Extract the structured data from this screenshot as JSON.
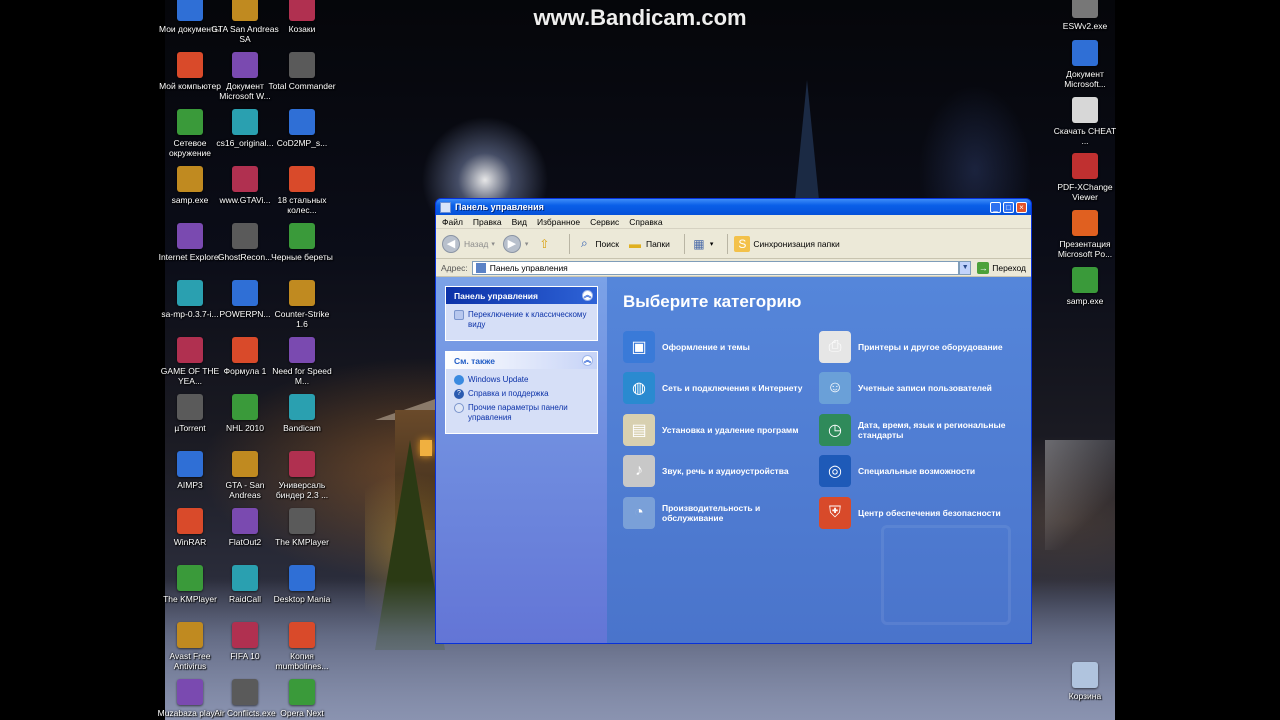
{
  "watermark": "www.Bandicam.com",
  "desktop_icons": {
    "col1": [
      {
        "label": "Мои документы",
        "icon": "folder-documents-icon"
      },
      {
        "label": "Мой компьютер",
        "icon": "computer-icon"
      },
      {
        "label": "Сетевое окружение",
        "icon": "network-icon"
      },
      {
        "label": "samp.exe",
        "icon": "samp-icon"
      },
      {
        "label": "Internet Explorer",
        "icon": "ie-icon"
      },
      {
        "label": "sa-mp-0.3.7-i...",
        "icon": "samp-installer-icon"
      },
      {
        "label": "GAME OF THE YEA...",
        "icon": "game-icon"
      },
      {
        "label": "µTorrent",
        "icon": "utorrent-icon"
      },
      {
        "label": "AIMP3",
        "icon": "aimp-icon"
      },
      {
        "label": "WinRAR",
        "icon": "winrar-icon"
      },
      {
        "label": "The KMPlayer",
        "icon": "kmplayer-icon"
      },
      {
        "label": "Avast Free Antivirus",
        "icon": "avast-icon"
      },
      {
        "label": "Muzabaza player",
        "icon": "muzabaza-icon"
      }
    ],
    "col2": [
      {
        "label": "GTA San Andreas SA",
        "icon": "gta-icon"
      },
      {
        "label": "Документ Microsoft W...",
        "icon": "word-doc-icon"
      },
      {
        "label": "cs16_original...",
        "icon": "archive-icon"
      },
      {
        "label": "www.GTAVi...",
        "icon": "opera-link-icon"
      },
      {
        "label": "GhostRecon...",
        "icon": "ghostrecon-icon"
      },
      {
        "label": "POWERPN...",
        "icon": "powerpoint-icon"
      },
      {
        "label": "Формула 1",
        "icon": "formula1-icon"
      },
      {
        "label": "NHL 2010",
        "icon": "nhl-icon"
      },
      {
        "label": "GTA - San Andreas",
        "icon": "gta-sa-icon"
      },
      {
        "label": "FlatOut2",
        "icon": "flatout-icon"
      },
      {
        "label": "RaidCall",
        "icon": "raidcall-icon"
      },
      {
        "label": "FIFA 10",
        "icon": "fifa-icon"
      },
      {
        "label": "Air Conflicts.exe",
        "icon": "airconflicts-icon"
      }
    ],
    "col3": [
      {
        "label": "Козаки",
        "icon": "kozaki-icon"
      },
      {
        "label": "Total Commander",
        "icon": "totalcmd-icon"
      },
      {
        "label": "CoD2MP_s...",
        "icon": "cod2-icon"
      },
      {
        "label": "18 стальных колес...",
        "icon": "truck-icon"
      },
      {
        "label": "Черные береты",
        "icon": "beret-icon"
      },
      {
        "label": "Counter-Strike 1.6",
        "icon": "cs-icon"
      },
      {
        "label": "Need for Speed M...",
        "icon": "nfs-icon"
      },
      {
        "label": "Bandicam",
        "icon": "bandicam-icon"
      },
      {
        "label": "Универсаль биндер 2.3 ...",
        "icon": "binder-icon"
      },
      {
        "label": "The KMPlayer",
        "icon": "kmplayer2-icon"
      },
      {
        "label": "Desktop Mania",
        "icon": "desktopmania-icon"
      },
      {
        "label": "Копия mumbolines...",
        "icon": "copy-icon"
      },
      {
        "label": "Opera Next",
        "icon": "opera-icon"
      }
    ],
    "right": [
      {
        "label": "ESWv2.exe",
        "icon": "exe-icon"
      },
      {
        "label": "Документ Microsoft...",
        "icon": "word-doc-icon"
      },
      {
        "label": "Скачать CHEAT ...",
        "icon": "cheat-icon"
      },
      {
        "label": "PDF-XChange Viewer",
        "icon": "pdf-icon"
      },
      {
        "label": "Презентация Microsoft Po...",
        "icon": "ppt-icon"
      },
      {
        "label": "samp.exe",
        "icon": "samp-exe-icon"
      },
      {
        "label": "Корзина",
        "icon": "recycle-bin-icon"
      }
    ]
  },
  "window": {
    "title": "Панель управления",
    "menu": [
      "Файл",
      "Правка",
      "Вид",
      "Избранное",
      "Сервис",
      "Справка"
    ],
    "toolbar": {
      "back": "Назад",
      "search": "Поиск",
      "folders": "Папки",
      "sync": "Синхронизация папки"
    },
    "address": {
      "label": "Адрес:",
      "value": "Панель управления",
      "go": "Переход"
    },
    "sidebar": {
      "panel_title": "Панель управления",
      "panel_items": [
        "Переключение к классическому виду"
      ],
      "see_also_title": "См. также",
      "see_also_items": [
        "Windows Update",
        "Справка и поддержка",
        "Прочие параметры панели управления"
      ]
    },
    "heading": "Выберите категорию",
    "categories": [
      {
        "label": "Оформление и темы",
        "icon": "appearance-icon"
      },
      {
        "label": "Принтеры и другое оборудование",
        "icon": "printer-icon"
      },
      {
        "label": "Сеть и подключения к Интернету",
        "icon": "network-connections-icon"
      },
      {
        "label": "Учетные записи пользователей",
        "icon": "user-accounts-icon"
      },
      {
        "label": "Установка и удаление программ",
        "icon": "add-remove-icon"
      },
      {
        "label": "Дата, время, язык и региональные стандарты",
        "icon": "datetime-icon"
      },
      {
        "label": "Звук, речь и аудиоустройства",
        "icon": "sound-icon"
      },
      {
        "label": "Специальные возможности",
        "icon": "accessibility-icon"
      },
      {
        "label": "Производительность и обслуживание",
        "icon": "performance-icon"
      },
      {
        "label": "Центр обеспечения безопасности",
        "icon": "security-center-icon"
      }
    ]
  },
  "colors": {
    "title_bar": "#0a5fe8",
    "left_pane": "#6d8ee0",
    "main_pane": "#4f7dd2"
  }
}
